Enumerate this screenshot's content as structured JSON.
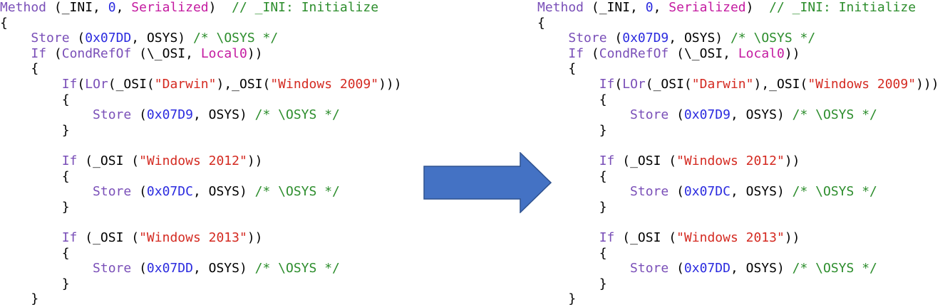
{
  "colors": {
    "keyword": "#7a4fb8",
    "number": "#2b2bdf",
    "string": "#d42a21",
    "special": "#c41aa0",
    "comment": "#2c8d2c",
    "plain": "#000000",
    "arrow_fill": "#4472c4",
    "arrow_stroke": "#2f528f"
  },
  "arrow_icon": "right-arrow-icon",
  "panels": {
    "before": {
      "lines": [
        [
          {
            "t": "Method",
            "c": "keyword"
          },
          {
            "t": " (_INI, ",
            "c": "plain"
          },
          {
            "t": "0",
            "c": "number"
          },
          {
            "t": ", ",
            "c": "plain"
          },
          {
            "t": "Serialized",
            "c": "special"
          },
          {
            "t": ")  ",
            "c": "plain"
          },
          {
            "t": "// _INI: Initialize",
            "c": "comment"
          }
        ],
        [
          {
            "t": "{",
            "c": "plain"
          }
        ],
        [
          {
            "t": "    ",
            "c": "plain"
          },
          {
            "t": "Store",
            "c": "keyword"
          },
          {
            "t": " (",
            "c": "plain"
          },
          {
            "t": "0x07DD",
            "c": "number"
          },
          {
            "t": ", OSYS) ",
            "c": "plain"
          },
          {
            "t": "/* \\OSYS */",
            "c": "comment"
          }
        ],
        [
          {
            "t": "    ",
            "c": "plain"
          },
          {
            "t": "If",
            "c": "keyword"
          },
          {
            "t": " (",
            "c": "plain"
          },
          {
            "t": "CondRefOf",
            "c": "keyword"
          },
          {
            "t": " (\\_OSI, ",
            "c": "plain"
          },
          {
            "t": "Local0",
            "c": "special"
          },
          {
            "t": "))",
            "c": "plain"
          }
        ],
        [
          {
            "t": "    {",
            "c": "plain"
          }
        ],
        [
          {
            "t": "        ",
            "c": "plain"
          },
          {
            "t": "If",
            "c": "keyword"
          },
          {
            "t": "(",
            "c": "plain"
          },
          {
            "t": "LOr",
            "c": "keyword"
          },
          {
            "t": "(_OSI(",
            "c": "plain"
          },
          {
            "t": "\"Darwin\"",
            "c": "string"
          },
          {
            "t": "),_OSI(",
            "c": "plain"
          },
          {
            "t": "\"Windows 2009\"",
            "c": "string"
          },
          {
            "t": ")))",
            "c": "plain"
          }
        ],
        [
          {
            "t": "        {",
            "c": "plain"
          }
        ],
        [
          {
            "t": "            ",
            "c": "plain"
          },
          {
            "t": "Store",
            "c": "keyword"
          },
          {
            "t": " (",
            "c": "plain"
          },
          {
            "t": "0x07D9",
            "c": "number"
          },
          {
            "t": ", OSYS) ",
            "c": "plain"
          },
          {
            "t": "/* \\OSYS */",
            "c": "comment"
          }
        ],
        [
          {
            "t": "        }",
            "c": "plain"
          }
        ],
        [],
        [
          {
            "t": "        ",
            "c": "plain"
          },
          {
            "t": "If",
            "c": "keyword"
          },
          {
            "t": " (_OSI (",
            "c": "plain"
          },
          {
            "t": "\"Windows 2012\"",
            "c": "string"
          },
          {
            "t": "))",
            "c": "plain"
          }
        ],
        [
          {
            "t": "        {",
            "c": "plain"
          }
        ],
        [
          {
            "t": "            ",
            "c": "plain"
          },
          {
            "t": "Store",
            "c": "keyword"
          },
          {
            "t": " (",
            "c": "plain"
          },
          {
            "t": "0x07DC",
            "c": "number"
          },
          {
            "t": ", OSYS) ",
            "c": "plain"
          },
          {
            "t": "/* \\OSYS */",
            "c": "comment"
          }
        ],
        [
          {
            "t": "        }",
            "c": "plain"
          }
        ],
        [],
        [
          {
            "t": "        ",
            "c": "plain"
          },
          {
            "t": "If",
            "c": "keyword"
          },
          {
            "t": " (_OSI (",
            "c": "plain"
          },
          {
            "t": "\"Windows 2013\"",
            "c": "string"
          },
          {
            "t": "))",
            "c": "plain"
          }
        ],
        [
          {
            "t": "        {",
            "c": "plain"
          }
        ],
        [
          {
            "t": "            ",
            "c": "plain"
          },
          {
            "t": "Store",
            "c": "keyword"
          },
          {
            "t": " (",
            "c": "plain"
          },
          {
            "t": "0x07DD",
            "c": "number"
          },
          {
            "t": ", OSYS) ",
            "c": "plain"
          },
          {
            "t": "/* \\OSYS */",
            "c": "comment"
          }
        ],
        [
          {
            "t": "        }",
            "c": "plain"
          }
        ],
        [
          {
            "t": "    }",
            "c": "plain"
          }
        ]
      ]
    },
    "after": {
      "lines": [
        [
          {
            "t": "Method",
            "c": "keyword"
          },
          {
            "t": " (_INI, ",
            "c": "plain"
          },
          {
            "t": "0",
            "c": "number"
          },
          {
            "t": ", ",
            "c": "plain"
          },
          {
            "t": "Serialized",
            "c": "special"
          },
          {
            "t": ")  ",
            "c": "plain"
          },
          {
            "t": "// _INI: Initialize",
            "c": "comment"
          }
        ],
        [
          {
            "t": "{",
            "c": "plain"
          }
        ],
        [
          {
            "t": "    ",
            "c": "plain"
          },
          {
            "t": "Store",
            "c": "keyword"
          },
          {
            "t": " (",
            "c": "plain"
          },
          {
            "t": "0x07D9",
            "c": "number"
          },
          {
            "t": ", OSYS) ",
            "c": "plain"
          },
          {
            "t": "/* \\OSYS */",
            "c": "comment"
          }
        ],
        [
          {
            "t": "    ",
            "c": "plain"
          },
          {
            "t": "If",
            "c": "keyword"
          },
          {
            "t": " (",
            "c": "plain"
          },
          {
            "t": "CondRefOf",
            "c": "keyword"
          },
          {
            "t": " (\\_OSI, ",
            "c": "plain"
          },
          {
            "t": "Local0",
            "c": "special"
          },
          {
            "t": "))",
            "c": "plain"
          }
        ],
        [
          {
            "t": "    {",
            "c": "plain"
          }
        ],
        [
          {
            "t": "        ",
            "c": "plain"
          },
          {
            "t": "If",
            "c": "keyword"
          },
          {
            "t": "(",
            "c": "plain"
          },
          {
            "t": "LOr",
            "c": "keyword"
          },
          {
            "t": "(_OSI(",
            "c": "plain"
          },
          {
            "t": "\"Darwin\"",
            "c": "string"
          },
          {
            "t": "),_OSI(",
            "c": "plain"
          },
          {
            "t": "\"Windows 2009\"",
            "c": "string"
          },
          {
            "t": ")))",
            "c": "plain"
          }
        ],
        [
          {
            "t": "        {",
            "c": "plain"
          }
        ],
        [
          {
            "t": "            ",
            "c": "plain"
          },
          {
            "t": "Store",
            "c": "keyword"
          },
          {
            "t": " (",
            "c": "plain"
          },
          {
            "t": "0x07D9",
            "c": "number"
          },
          {
            "t": ", OSYS) ",
            "c": "plain"
          },
          {
            "t": "/* \\OSYS */",
            "c": "comment"
          }
        ],
        [
          {
            "t": "        }",
            "c": "plain"
          }
        ],
        [],
        [
          {
            "t": "        ",
            "c": "plain"
          },
          {
            "t": "If",
            "c": "keyword"
          },
          {
            "t": " (_OSI (",
            "c": "plain"
          },
          {
            "t": "\"Windows 2012\"",
            "c": "string"
          },
          {
            "t": "))",
            "c": "plain"
          }
        ],
        [
          {
            "t": "        {",
            "c": "plain"
          }
        ],
        [
          {
            "t": "            ",
            "c": "plain"
          },
          {
            "t": "Store",
            "c": "keyword"
          },
          {
            "t": " (",
            "c": "plain"
          },
          {
            "t": "0x07DC",
            "c": "number"
          },
          {
            "t": ", OSYS) ",
            "c": "plain"
          },
          {
            "t": "/* \\OSYS */",
            "c": "comment"
          }
        ],
        [
          {
            "t": "        }",
            "c": "plain"
          }
        ],
        [],
        [
          {
            "t": "        ",
            "c": "plain"
          },
          {
            "t": "If",
            "c": "keyword"
          },
          {
            "t": " (_OSI (",
            "c": "plain"
          },
          {
            "t": "\"Windows 2013\"",
            "c": "string"
          },
          {
            "t": "))",
            "c": "plain"
          }
        ],
        [
          {
            "t": "        {",
            "c": "plain"
          }
        ],
        [
          {
            "t": "            ",
            "c": "plain"
          },
          {
            "t": "Store",
            "c": "keyword"
          },
          {
            "t": " (",
            "c": "plain"
          },
          {
            "t": "0x07DD",
            "c": "number"
          },
          {
            "t": ", OSYS) ",
            "c": "plain"
          },
          {
            "t": "/* \\OSYS */",
            "c": "comment"
          }
        ],
        [
          {
            "t": "        }",
            "c": "plain"
          }
        ],
        [
          {
            "t": "    }",
            "c": "plain"
          }
        ]
      ]
    }
  }
}
